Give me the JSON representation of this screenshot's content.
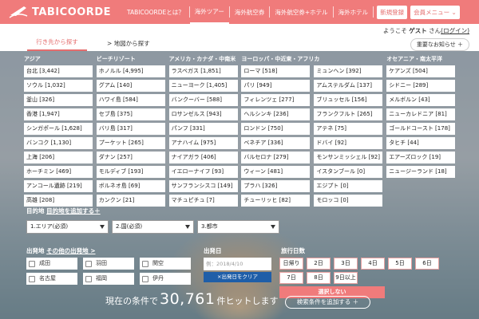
{
  "brand": {
    "name": "TABICOORDE",
    "accent": "#f07b7b"
  },
  "nav": {
    "items": [
      "TABICOORDEとは？",
      "海外ツアー",
      "海外航空券",
      "海外航空券+ホテル",
      "海外ホテル"
    ],
    "register": "新規登録",
    "member_menu": "会員メニュー",
    "member_caret": "⌄"
  },
  "userbar": {
    "welcome": "ようこそ",
    "guest": "ゲスト",
    "suffix": "さん",
    "login": "(ログイン)"
  },
  "tabs": {
    "active": "行き先から探す",
    "other": "> 地図から探す",
    "notice": "重要なお知らせ ＋"
  },
  "regions": [
    {
      "name": "アジア",
      "items": [
        "台北 [3,442]",
        "ソウル [1,032]",
        "釜山 [326]",
        "香港 [1,947]",
        "シンガポール [1,628]",
        "バンコク [1,130]",
        "上海 [206]",
        "ホーチミン [469]",
        "アンコール遺跡 [219]",
        "高雄 [208]"
      ]
    },
    {
      "name": "ビーチリゾート",
      "items": [
        "ホノルル [4,995]",
        "グアム [140]",
        "ハワイ島 [584]",
        "セブ島 [375]",
        "バリ島 [317]",
        "プーケット [265]",
        "ダナン [257]",
        "モルディブ [193]",
        "ボルネオ島 [69]",
        "カンクン [21]"
      ]
    },
    {
      "name": "アメリカ・カナダ・中南米",
      "items": [
        "ラスベガス [1,851]",
        "ニューヨーク [1,405]",
        "バンクーバー [588]",
        "ロサンゼルス [943]",
        "パンフ [331]",
        "アナハイム [975]",
        "ナイアガラ [406]",
        "イエローナイフ [93]",
        "サンフランシスコ [149]",
        "マチュピチュ [7]"
      ]
    },
    {
      "name": "ヨーロッパ・中近東・アフリカ",
      "items": [
        "ローマ [518]",
        "パリ [949]",
        "フィレンツェ [277]",
        "ヘルシンキ [236]",
        "ロンドン [750]",
        "ベネチア [336]",
        "バルセロナ [279]",
        "ウィーン [481]",
        "プラハ [326]",
        "チューリッヒ [82]"
      ]
    },
    {
      "name": "",
      "items": [
        "ミュンヘン [392]",
        "アムステルダム [137]",
        "ブリュッセル [156]",
        "フランクフルト [265]",
        "アテネ [75]",
        "ドバイ [92]",
        "モンサンミッシェル [92]",
        "イスタンブール [0]",
        "エジプト [0]",
        "モロッコ [0]"
      ]
    },
    {
      "name": "オセアニア・南太平洋",
      "items": [
        "ケアンズ [504]",
        "シドニー [289]",
        "メルボルン [43]",
        "ニューカレドニア [81]",
        "ゴールドコースト [178]",
        "タヒチ [44]",
        "エアーズロック [19]",
        "ニュージーランド [18]"
      ]
    }
  ],
  "destination": {
    "label": "目的地",
    "add_link": "目的地を追加する＋",
    "selects": [
      "1.エリア(必須)",
      "2.国(必須)",
      "3.都市"
    ]
  },
  "departure": {
    "label": "出発地",
    "other_link": "その他の出発地 >",
    "airports": [
      "成田",
      "羽田",
      "関空",
      "名古屋",
      "福岡",
      "伊丹"
    ]
  },
  "date": {
    "label": "出発日",
    "placeholder": "例：2018/4/10",
    "clear": "×出発日をクリア"
  },
  "days": {
    "label": "旅行日数",
    "options": [
      "日帰り",
      "2日",
      "3日",
      "4日",
      "5日",
      "6日",
      "7日",
      "8日",
      "9日以上"
    ],
    "unselect": "選択しない"
  },
  "result": {
    "prefix": "現在の条件で",
    "count": "30,761",
    "suffix": "件ヒットします",
    "add_button": "検索条件を追加する ＋"
  }
}
